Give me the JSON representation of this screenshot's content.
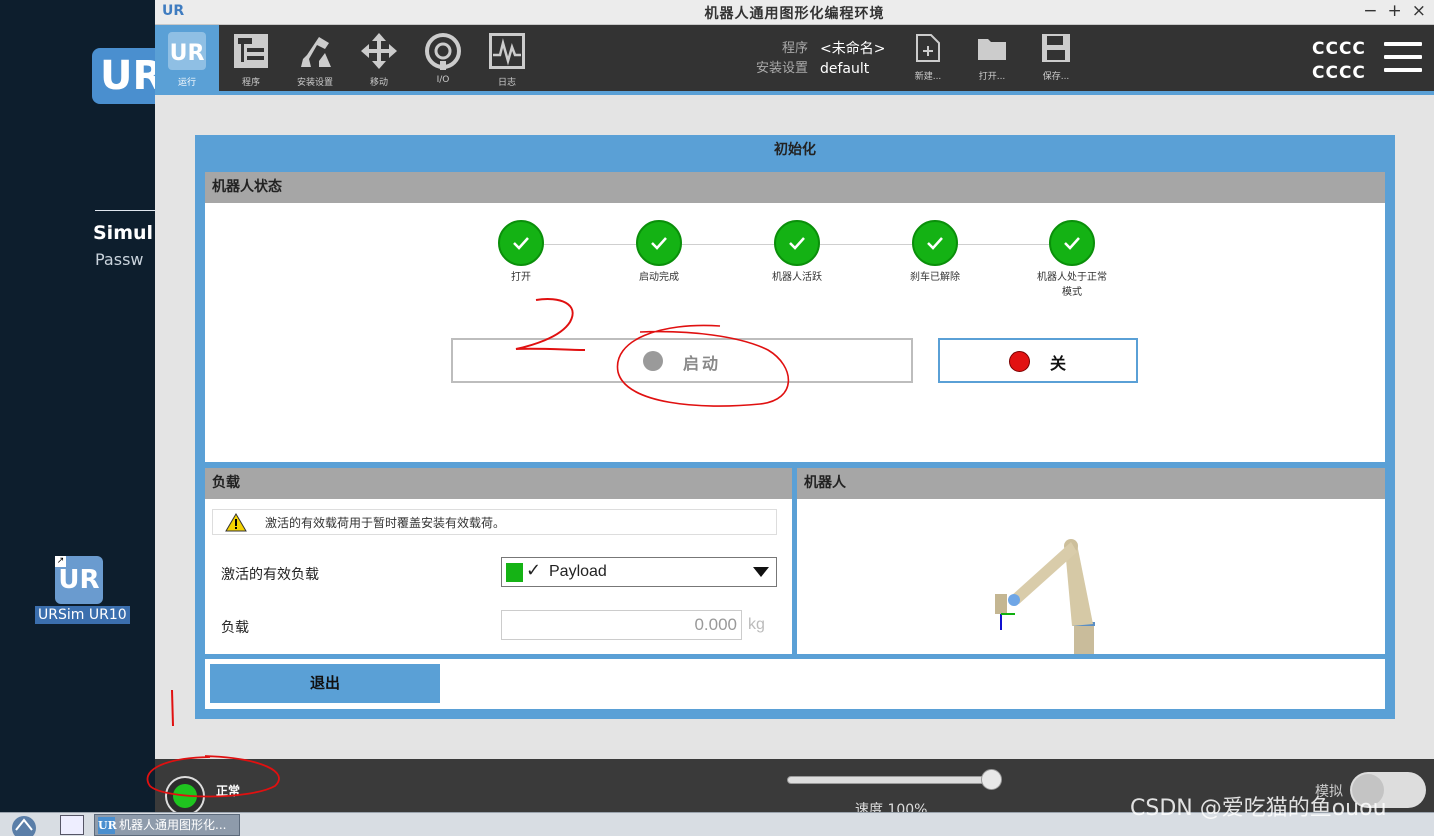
{
  "window": {
    "title": "机器人通用图形化编程环境",
    "controls": [
      "−",
      "+",
      "×"
    ]
  },
  "desktop": {
    "logo_text": "UR",
    "simul": "Simul",
    "passw": "Passw",
    "shortcut_label": "URSim UR10"
  },
  "toolbar": {
    "tabs": [
      {
        "label": "运行",
        "icon": "ur-logo-icon",
        "active": true
      },
      {
        "label": "程序",
        "icon": "program-icon"
      },
      {
        "label": "安装设置",
        "icon": "installation-robot-icon"
      },
      {
        "label": "移动",
        "icon": "move-arrows-icon"
      },
      {
        "label": "I/O",
        "icon": "io-icon"
      },
      {
        "label": "日志",
        "icon": "log-icon"
      }
    ],
    "program_label": "程序",
    "program_value": "<未命名>",
    "installation_label": "安装设置",
    "installation_value": "default",
    "new_label": "新建...",
    "open_label": "打开...",
    "save_label": "保存...",
    "status_line1": "CCCC",
    "status_line2": "CCCC"
  },
  "dialog": {
    "title": "初始化",
    "robot_state": {
      "header": "机器人状态",
      "steps": [
        {
          "label": "打开",
          "done": true
        },
        {
          "label": "启动完成",
          "done": true
        },
        {
          "label": "机器人活跃",
          "done": true
        },
        {
          "label": "刹车已解除",
          "done": true
        },
        {
          "label": "机器人处于正常 模式",
          "done": true
        }
      ],
      "on_button": "启动",
      "off_button": "关"
    },
    "payload": {
      "header": "负载",
      "warning": "激活的有效载荷用于暂时覆盖安装有效载荷。",
      "active_label": "激活的有效负载",
      "active_value": "Payload",
      "mass_label": "负载",
      "mass_value": "0.000",
      "mass_unit": "kg"
    },
    "robot": {
      "header": "机器人"
    },
    "exit_button": "退出"
  },
  "footer": {
    "status": "正常",
    "speed_label": "速度",
    "speed_value": "100%",
    "speed": 1.0,
    "simulation_label": "模拟",
    "simulation_on": false
  },
  "taskbar": {
    "task_label": "机器人通用图形化..."
  },
  "annotations": {
    "handwritten_number": "2"
  },
  "watermark": "CSDN @爱吃猫的鱼ouou",
  "colors": {
    "accent": "#5aa0d6",
    "ok_green": "#14b214",
    "stop_red": "#e21212",
    "toolbar_bg": "#333333"
  }
}
